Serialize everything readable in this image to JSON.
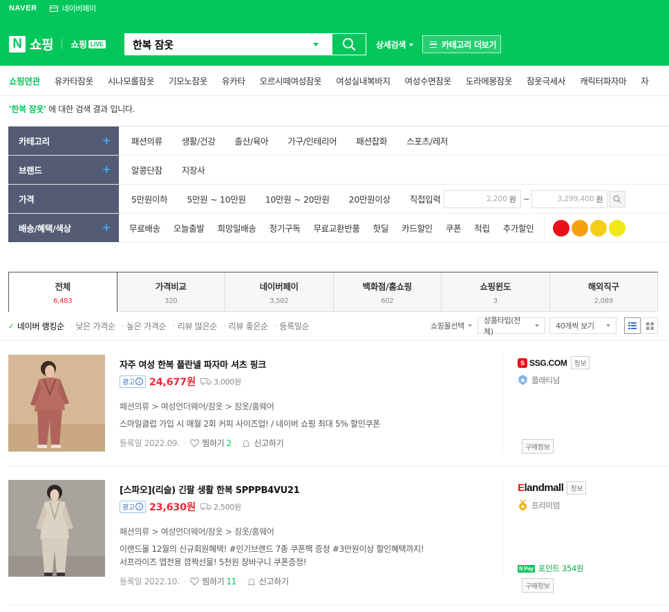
{
  "topbar": {
    "naver": "NAVER",
    "npay": "네이버페이"
  },
  "header": {
    "logo_n": "N",
    "logo_shop": "쇼핑",
    "logo_live": "쇼핑",
    "logo_live_tag": "LIVE",
    "search_value": "한복 잠옷",
    "detail_search": "상세검색",
    "category_more": "카테고리 더보기"
  },
  "related": {
    "label": "쇼핑연관",
    "keywords": [
      "유카타잠옷",
      "시나모롤잠옷",
      "기모노잠옷",
      "유카타",
      "오르시떼여성잠옷",
      "여성실내복바지",
      "여성수면잠옷",
      "도라에몽잠옷",
      "잠옷극세사",
      "캐릭터파자마",
      "자"
    ]
  },
  "notice": {
    "query": "'한복 잠옷'",
    "text": " 에 대한 검색 결과 입니다."
  },
  "filters": {
    "category": {
      "label": "카테고리",
      "items": [
        "패션의류",
        "생활/건강",
        "출산/육아",
        "가구/인테리어",
        "패션잡화",
        "스포츠/레저"
      ]
    },
    "brand": {
      "label": "브랜드",
      "items": [
        "알콩단잠",
        "지장사"
      ]
    },
    "price": {
      "label": "가격",
      "items": [
        "5만원이하",
        "5만원 ~ 10만원",
        "10만원 ~ 20만원",
        "20만원이상"
      ],
      "direct": "직접입력",
      "min": "2,200",
      "max": "3,299,400",
      "won": "원",
      "tilde": "~"
    },
    "benefit": {
      "label": "배송/혜택/색상",
      "items": [
        "무료배송",
        "오늘출발",
        "희망일배송",
        "정기구독",
        "무료교환반품",
        "핫딜",
        "카드할인",
        "쿠폰",
        "적립",
        "추가할인"
      ],
      "colors": [
        "#e8111a",
        "#f5a10f",
        "#f5cd1a",
        "#f2e81b"
      ]
    }
  },
  "tabs": [
    {
      "name": "전체",
      "count": "6,483"
    },
    {
      "name": "가격비교",
      "count": "320"
    },
    {
      "name": "네이버페이",
      "count": "3,502"
    },
    {
      "name": "백화점/홈쇼핑",
      "count": "602"
    },
    {
      "name": "쇼핑윈도",
      "count": "3"
    },
    {
      "name": "해외직구",
      "count": "2,089"
    }
  ],
  "sort": {
    "options": [
      "네이버 랭킹순",
      "낮은 가격순",
      "높은 가격순",
      "리뷰 많은순",
      "리뷰 좋은순",
      "등록일순"
    ],
    "mall_select": "쇼핑몰선택",
    "product_type": "상품타입(전체)",
    "view_count": "40개씩 보기"
  },
  "items": [
    {
      "title": "자주 여성 한복 플란넬 파자마 셔츠 핑크",
      "ad": "광고",
      "price": "24,677원",
      "shipping": "3,000원",
      "category": "패션의류 > 여성언더웨어/잠옷 > 잠옷/홈웨어",
      "desc1": "스마일클럽 가입 시 매월 2회 커피 사이즈업! / 네이버 쇼핑 최대 5% 할인쿠폰",
      "desc2": "",
      "date": "등록일 2022.09.",
      "zzim": "찜하기",
      "zzim_count": "2",
      "report": "신고하기",
      "mall_logo": "SSG.COM",
      "mall_tag": "정보",
      "grade": "플래티넘",
      "buy_info": "구매정보",
      "point": ""
    },
    {
      "title": "[스파오](리슬) 긴팔 생활 한복 SPPPB4VU21",
      "ad": "광고",
      "price": "23,630원",
      "shipping": "2,500원",
      "category": "패션의류 > 여성언더웨어/잠옷 > 잠옷/홈웨어",
      "desc1": "이랜드몰 12월의 신규회원혜택! #인기브랜드 7종 쿠폰팩 증정 #3만원이상 할인혜택까지!",
      "desc2": "서프라이즈 앱전용 깜짝선물! 5천원 장바구니 쿠폰증정!",
      "date": "등록일 2022.10.",
      "zzim": "찜하기",
      "zzim_count": "11",
      "report": "신고하기",
      "mall_logo": "landmall",
      "mall_logo_e": "E",
      "mall_tag": "정보",
      "grade": "프리미엄",
      "buy_info": "구매정보",
      "point_pay": "N Pay",
      "point": "포인트 354원"
    }
  ]
}
